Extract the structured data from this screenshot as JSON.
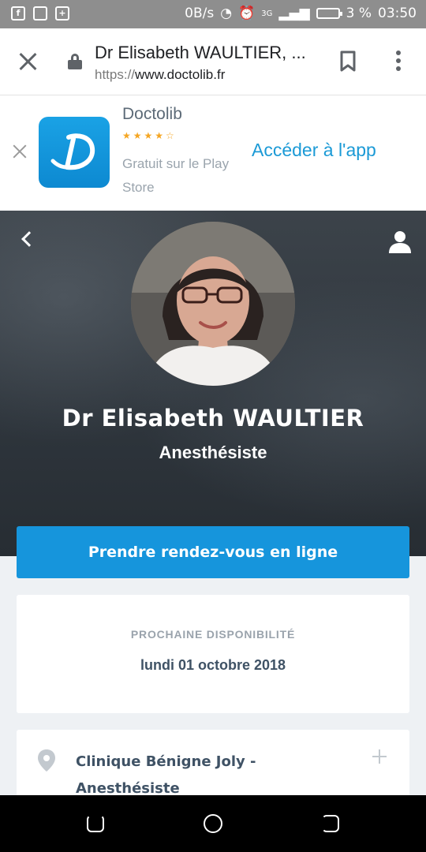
{
  "status_bar": {
    "net_speed": "0B/s",
    "network": "3G",
    "battery": "3 %",
    "time": "03:50"
  },
  "browser": {
    "page_title": "Dr Elisabeth WAULTIER, ...",
    "url_scheme": "https://",
    "url_host": "www.doctolib.fr"
  },
  "app_banner": {
    "app_name": "Doctolib",
    "rating": "★★★★☆",
    "subtitle": "Gratuit sur le Play Store",
    "open_label": "Accéder à l'app"
  },
  "profile": {
    "name": "Dr Elisabeth WAULTIER",
    "specialty": "Anesthésiste"
  },
  "booking": {
    "button_label": "Prendre rendez-vous en ligne"
  },
  "availability": {
    "label": "PROCHAINE DISPONIBILITÉ",
    "date": "lundi 01 octobre 2018"
  },
  "clinic": {
    "name": "Clinique Bénigne Joly - Anesthésiste"
  },
  "colors": {
    "accent": "#1695dc",
    "text_dark": "#3f5265",
    "hero_bg": "#2e353c"
  }
}
